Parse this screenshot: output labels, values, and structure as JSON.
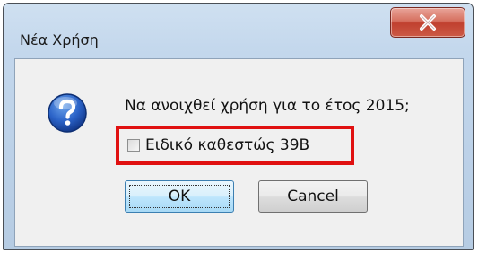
{
  "dialog": {
    "title": "Νέα Χρήση",
    "message": "Να ανοιχθεί χρήση για το έτος 2015;",
    "checkbox": {
      "label": "Ειδικό καθεστώς 39Β",
      "checked": false,
      "highlight_color": "#e01010"
    },
    "buttons": {
      "ok": "OK",
      "cancel": "Cancel"
    },
    "icons": {
      "question": "question-icon",
      "close": "close-icon"
    }
  }
}
